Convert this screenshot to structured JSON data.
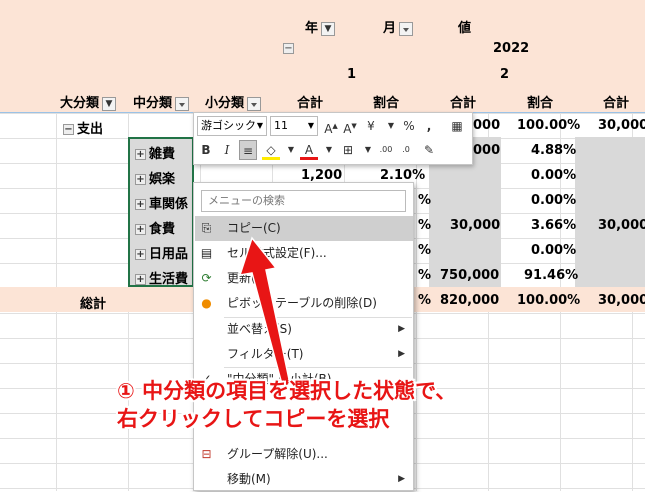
{
  "header_row1": {
    "year": "年",
    "month": "月",
    "value": "値"
  },
  "header_row2": {
    "year_2022": "2022"
  },
  "header_row3": {
    "m1": "1",
    "m2": "2"
  },
  "header_row4": {
    "daibunrui": "大分類",
    "chubunrui": "中分類",
    "shobunrui": "小分類",
    "total1": "合計",
    "ratio1": "割合",
    "total2": "合計",
    "ratio2": "割合",
    "total3": "合計"
  },
  "row_shishutsu": {
    "label": "支出",
    "total2": "000",
    "ratio2": "100.00%",
    "total3": "30,000"
  },
  "row_zappi": {
    "label": "雑費",
    "total2": "000",
    "ratio2": "4.88%"
  },
  "row_goraku": {
    "label": "娯楽",
    "total1": "1,200",
    "ratio1": "2.10%",
    "ratio2": "0.00%"
  },
  "row_shakankei": {
    "label": "車関係",
    "ratio1": "%",
    "ratio2": "0.00%"
  },
  "row_shokuhi": {
    "label": "食費",
    "ratio1": "%",
    "total2": "30,000",
    "ratio2": "3.66%",
    "total3": "30,000"
  },
  "row_nichiyohin": {
    "label": "日用品",
    "ratio1": "%",
    "ratio2": "0.00%"
  },
  "row_seikatsuhi": {
    "label": "生活費",
    "ratio1": "%",
    "total2": "750,000",
    "ratio2": "91.46%"
  },
  "row_total": {
    "label": "総計",
    "ratio1": "%",
    "total2": "820,000",
    "ratio2": "100.00%",
    "total3": "30,000"
  },
  "mini_toolbar": {
    "font": "游ゴシック",
    "size": "11"
  },
  "context_menu": {
    "search_placeholder": "メニューの検索",
    "items": [
      {
        "label": "コピー(C)",
        "icon": "copy-icon"
      },
      {
        "label": "セル書式設定(F)...",
        "icon": "format-cells-icon"
      },
      {
        "label": "更新(R)",
        "icon": "refresh-icon"
      },
      {
        "label": "ピボットテーブルの削除(D)",
        "icon": "delete-pivot-icon"
      },
      {
        "label": "並べ替え(S)",
        "icon": ""
      },
      {
        "label": "フィルター(T)",
        "icon": ""
      },
      {
        "label": "\"中分類\" の小計(B)",
        "icon": "check-icon"
      },
      {
        "label": "",
        "icon": ""
      },
      {
        "label": "",
        "icon": ""
      },
      {
        "label": "グループ解除(U)...",
        "icon": "ungroup-icon"
      },
      {
        "label": "移動(M)",
        "icon": ""
      }
    ]
  },
  "annotation": {
    "line1": "① 中分類の項目を選択した状態で、",
    "line2": "右クリックしてコピーを選択"
  },
  "colors": {
    "header_band": "#fce4d6",
    "selection": "#cfcfcf",
    "annotation": "#e81515"
  }
}
